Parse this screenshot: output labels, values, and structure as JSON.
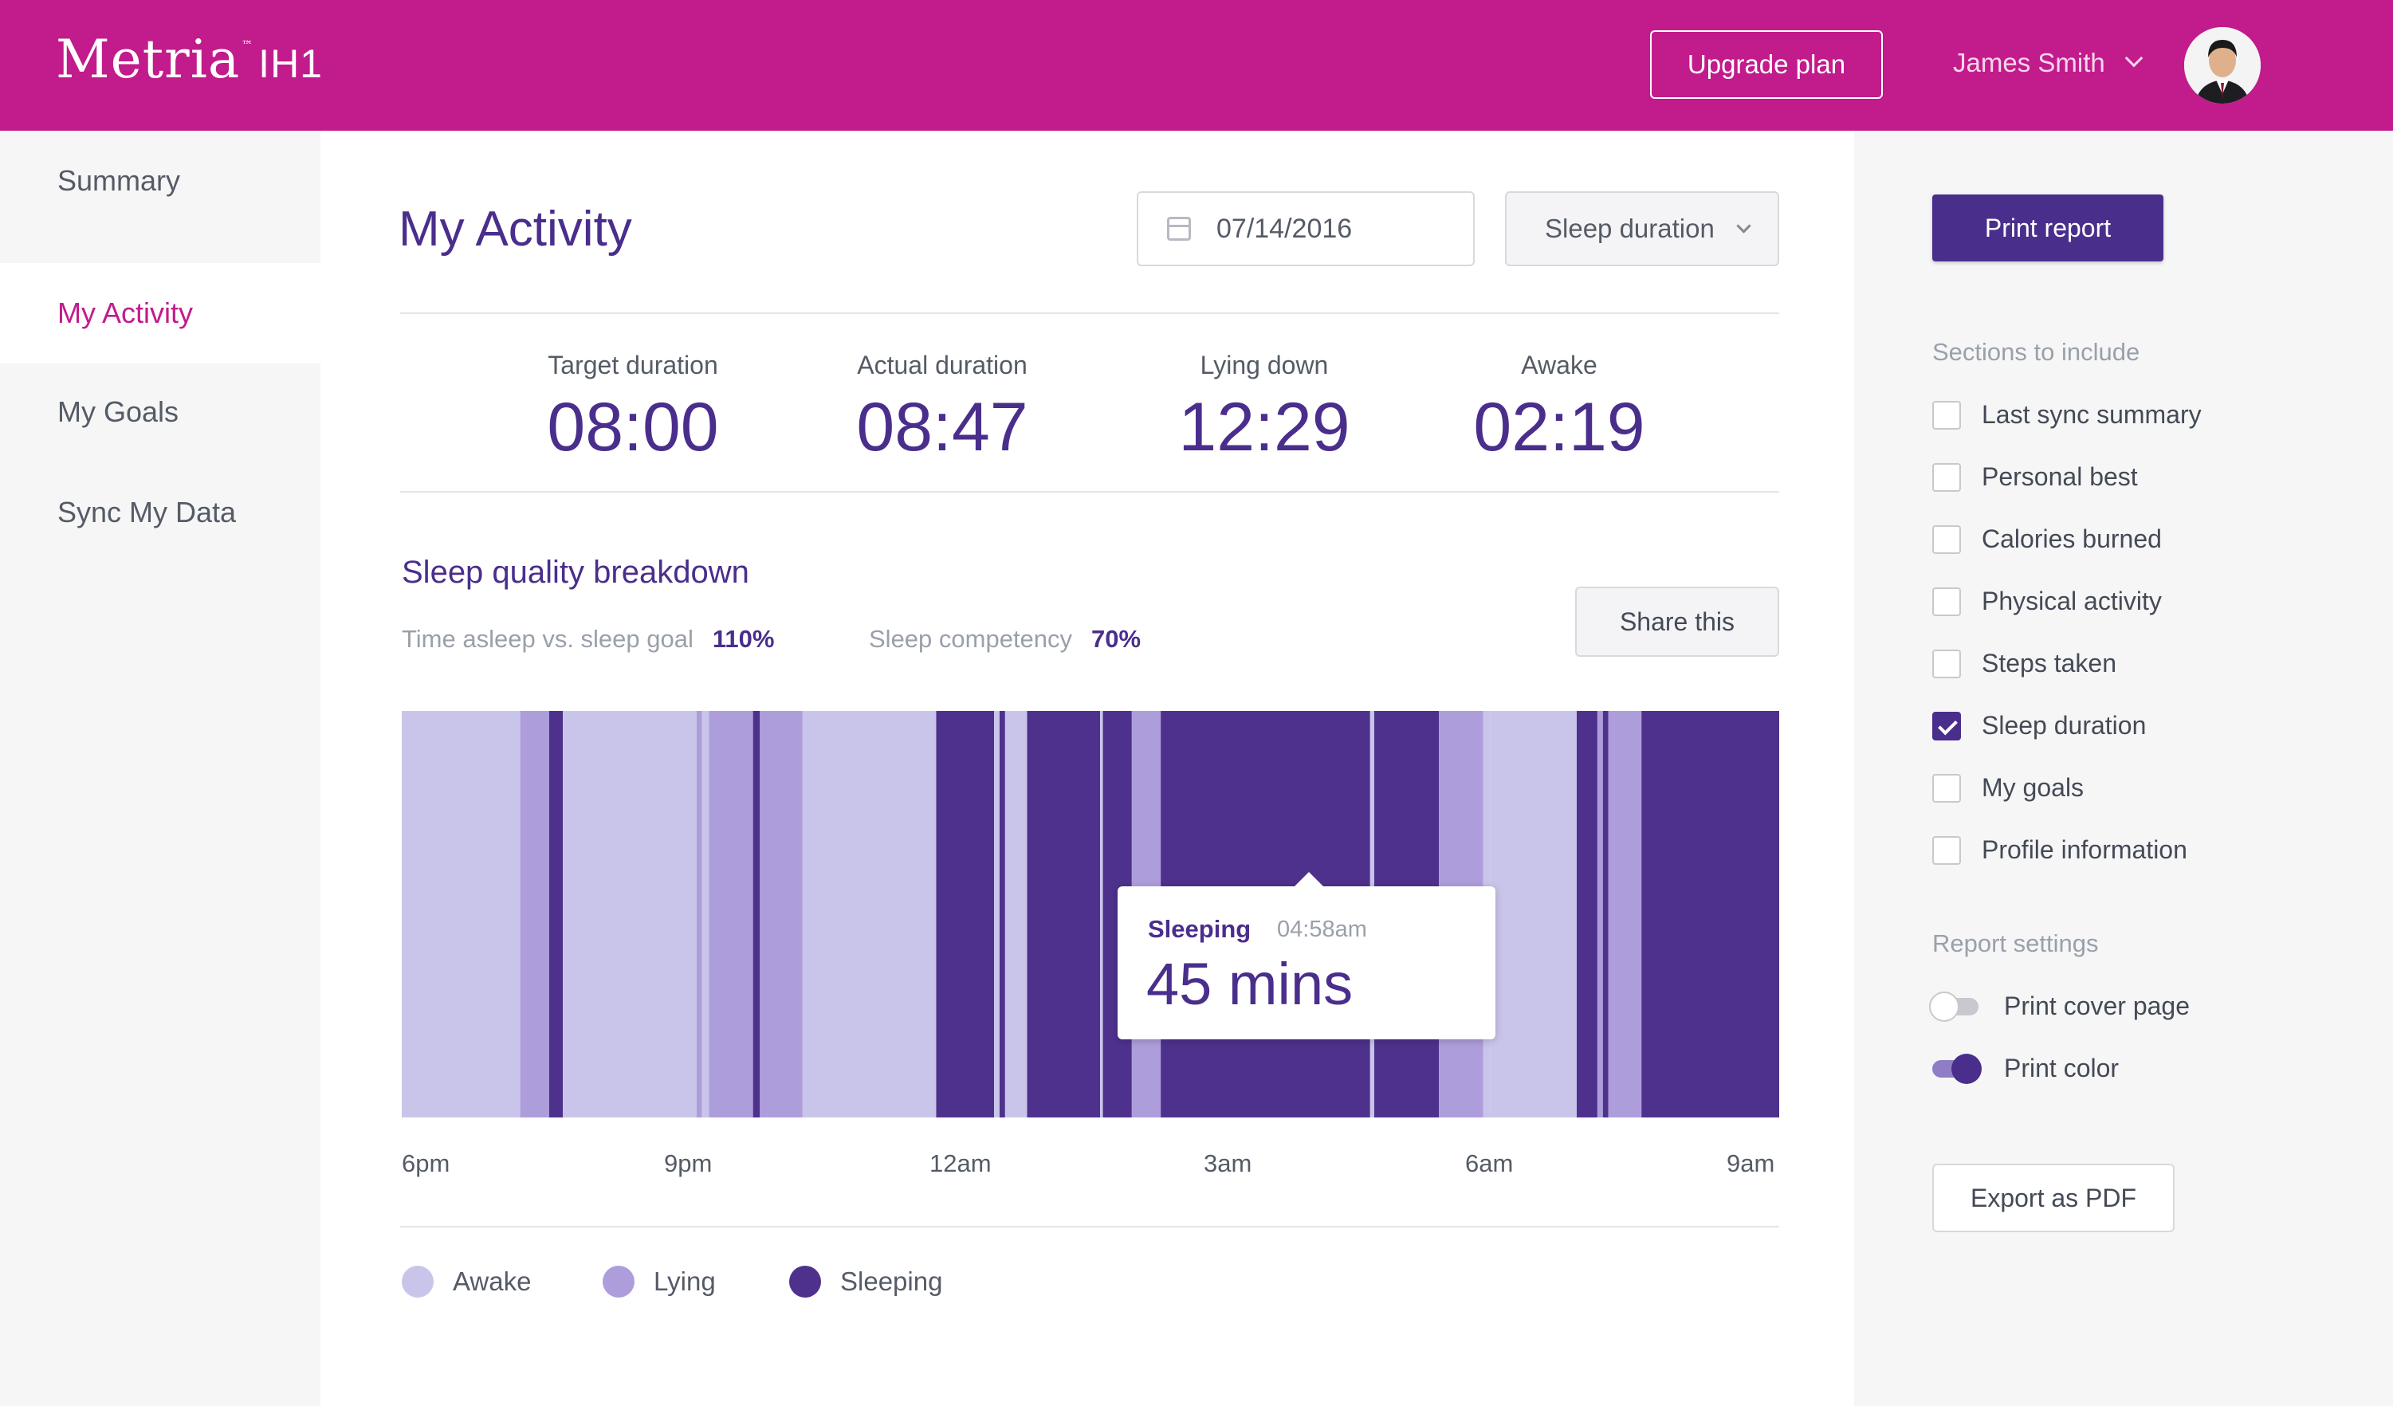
{
  "header": {
    "logo": "Metria",
    "logo_tm": "™",
    "logo_model": "IH1",
    "upgrade_label": "Upgrade plan",
    "user_name": "James Smith",
    "brand_color": "#c21b8c"
  },
  "nav": {
    "items": [
      {
        "label": "Summary"
      },
      {
        "label": "My Activity"
      },
      {
        "label": "My Goals"
      },
      {
        "label": "Sync My Data"
      }
    ],
    "active": "My Activity"
  },
  "main": {
    "title": "My Activity",
    "date_value": "07/14/2016",
    "metric_select": "Sleep duration",
    "stats": [
      {
        "label": "Target duration",
        "value": "08:00"
      },
      {
        "label": "Actual duration",
        "value": "08:47"
      },
      {
        "label": "Lying down",
        "value": "12:29"
      },
      {
        "label": "Awake",
        "value": "02:19"
      }
    ],
    "section_title": "Sleep quality breakdown",
    "kpis": [
      {
        "label": "Time asleep vs. sleep goal",
        "value": "110%"
      },
      {
        "label": "Sleep competency",
        "value": "70%"
      }
    ],
    "share_label": "Share this",
    "tooltip": {
      "state": "Sleeping",
      "time": "04:58am",
      "duration": "45 mins"
    }
  },
  "chart_data": {
    "type": "timeline",
    "x_range": [
      "6pm",
      "9am"
    ],
    "x_ticks": [
      "6pm",
      "9pm",
      "12am",
      "3am",
      "6am",
      "9am"
    ],
    "colors": {
      "Awake": "#c9c5ea",
      "Lying": "#ae9ddb",
      "Sleeping": "#4e318c"
    },
    "legend": [
      "Awake",
      "Lying",
      "Sleeping"
    ],
    "segments": [
      {
        "state": "Awake",
        "from": 0.0,
        "to": 0.086
      },
      {
        "state": "Lying",
        "from": 0.086,
        "to": 0.107
      },
      {
        "state": "Sleeping",
        "from": 0.107,
        "to": 0.117
      },
      {
        "state": "Awake",
        "from": 0.117,
        "to": 0.214
      },
      {
        "state": "Lying",
        "from": 0.214,
        "to": 0.218
      },
      {
        "state": "Awake",
        "from": 0.218,
        "to": 0.223
      },
      {
        "state": "Lying",
        "from": 0.223,
        "to": 0.255
      },
      {
        "state": "Sleeping",
        "from": 0.255,
        "to": 0.26
      },
      {
        "state": "Lying",
        "from": 0.26,
        "to": 0.291
      },
      {
        "state": "Awake",
        "from": 0.291,
        "to": 0.388
      },
      {
        "state": "Sleeping",
        "from": 0.388,
        "to": 0.43
      },
      {
        "state": "Awake",
        "from": 0.43,
        "to": 0.434
      },
      {
        "state": "Sleeping",
        "from": 0.434,
        "to": 0.438
      },
      {
        "state": "Awake",
        "from": 0.438,
        "to": 0.454
      },
      {
        "state": "Sleeping",
        "from": 0.454,
        "to": 0.507
      },
      {
        "state": "Awake",
        "from": 0.507,
        "to": 0.509
      },
      {
        "state": "Sleeping",
        "from": 0.509,
        "to": 0.53
      },
      {
        "state": "Lying",
        "from": 0.53,
        "to": 0.551
      },
      {
        "state": "Sleeping",
        "from": 0.551,
        "to": 0.703
      },
      {
        "state": "Awake",
        "from": 0.703,
        "to": 0.706
      },
      {
        "state": "Sleeping",
        "from": 0.706,
        "to": 0.753
      },
      {
        "state": "Lying",
        "from": 0.753,
        "to": 0.785
      },
      {
        "state": "Awake",
        "from": 0.785,
        "to": 0.79
      },
      {
        "state": "Awake",
        "from": 0.79,
        "to": 0.853
      },
      {
        "state": "Sleeping",
        "from": 0.853,
        "to": 0.868
      },
      {
        "state": "Lying",
        "from": 0.868,
        "to": 0.872
      },
      {
        "state": "Sleeping",
        "from": 0.872,
        "to": 0.876
      },
      {
        "state": "Lying",
        "from": 0.876,
        "to": 0.9
      },
      {
        "state": "Sleeping",
        "from": 0.9,
        "to": 1.0
      }
    ]
  },
  "report": {
    "print_label": "Print report",
    "sections_heading": "Sections to include",
    "sections": [
      {
        "label": "Last sync summary",
        "checked": false
      },
      {
        "label": "Personal best",
        "checked": false
      },
      {
        "label": "Calories burned",
        "checked": false
      },
      {
        "label": "Physical activity",
        "checked": false
      },
      {
        "label": "Steps taken",
        "checked": false
      },
      {
        "label": "Sleep duration",
        "checked": true
      },
      {
        "label": "My goals",
        "checked": false
      },
      {
        "label": "Profile information",
        "checked": false
      }
    ],
    "settings_heading": "Report settings",
    "settings": [
      {
        "label": "Print cover page",
        "on": false
      },
      {
        "label": "Print color",
        "on": true
      }
    ],
    "export_label": "Export as PDF",
    "accent_color": "#4a2e8c"
  }
}
